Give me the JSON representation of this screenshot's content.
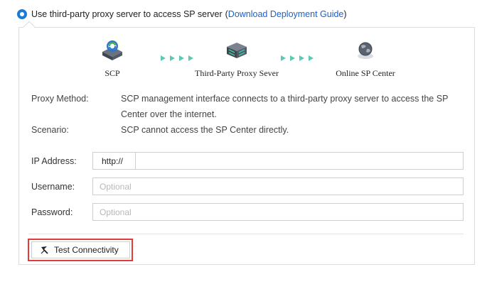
{
  "option": {
    "label": "Use third-party proxy server to access SP server",
    "link_open": "(",
    "link_text": "Download Deployment Guide",
    "link_close": ")"
  },
  "diagram": {
    "nodes": [
      {
        "label": "SCP",
        "icon": "scp-device-icon"
      },
      {
        "label": "Third-Party Proxy Sever",
        "icon": "proxy-server-icon"
      },
      {
        "label": "Online SP Center",
        "icon": "globe-icon"
      }
    ]
  },
  "info": {
    "method_key": "Proxy Method:",
    "method_value": "SCP management interface connects to a third-party proxy server to access the SP Center over the internet.",
    "scenario_key": "Scenario:",
    "scenario_value": "SCP cannot access the SP Center directly."
  },
  "form": {
    "ip_label": "IP Address:",
    "ip_prefix": "http://",
    "ip_value": "",
    "username_label": "Username:",
    "username_placeholder": "Optional",
    "password_label": "Password:",
    "password_placeholder": "Optional"
  },
  "actions": {
    "test_label": "Test Connectivity"
  },
  "colors": {
    "accent": "#1a7bd8",
    "link": "#1a62c9",
    "arrow": "#5cc9b3",
    "highlight": "#e23b3b"
  }
}
